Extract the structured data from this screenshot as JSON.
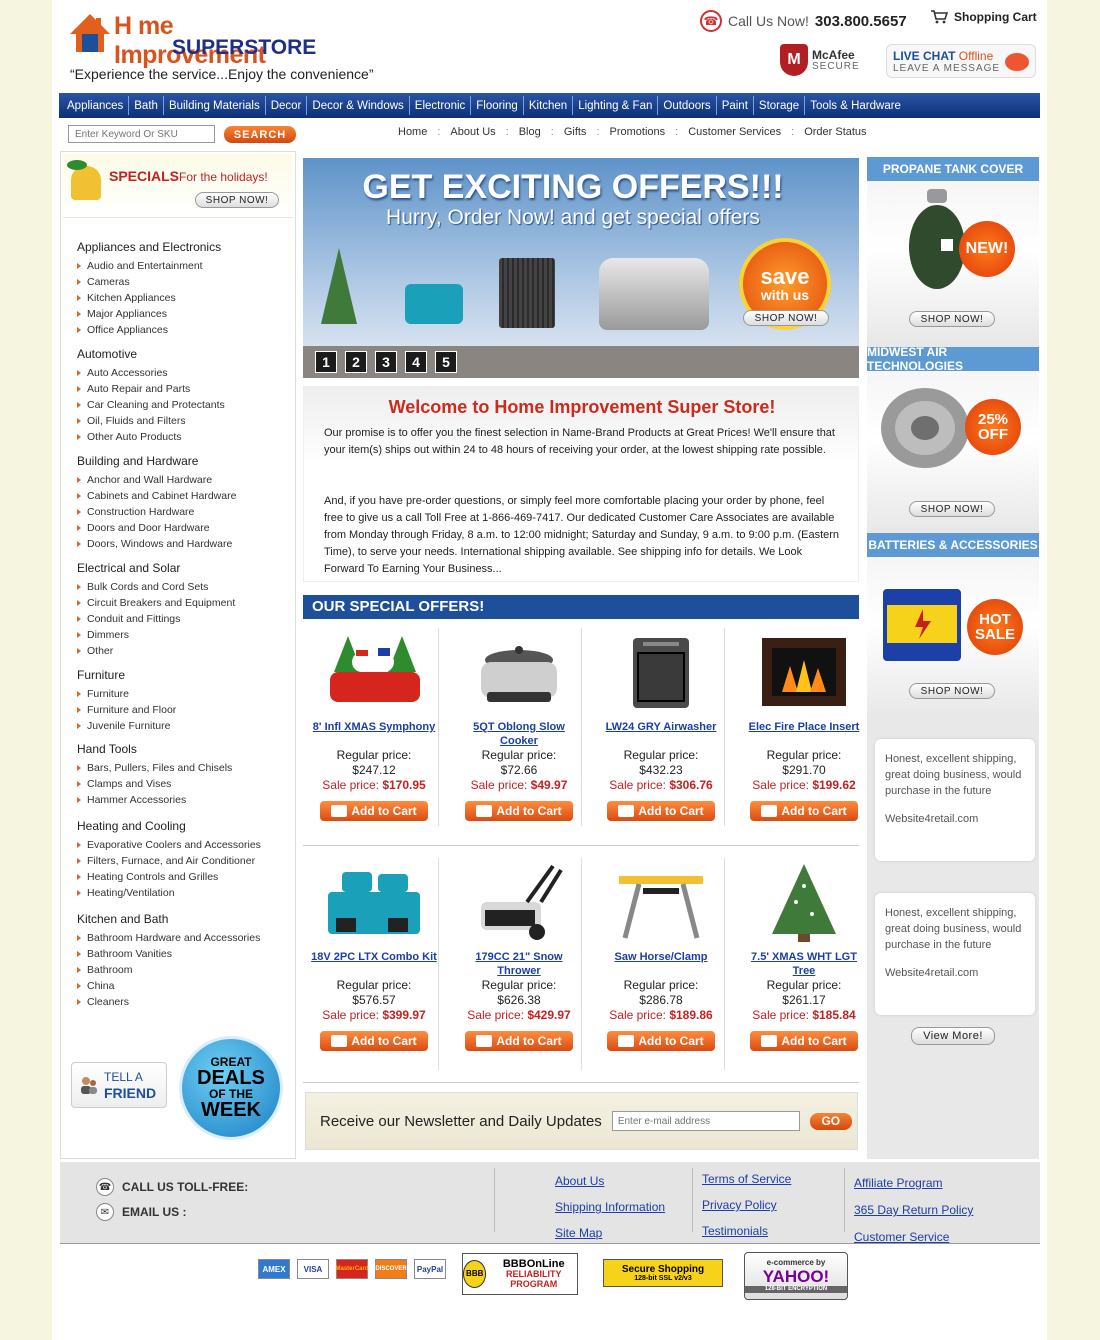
{
  "header": {
    "logo_line1": "H me Improvement",
    "logo_line2": "SUPERSTORE",
    "tagline": "“Experience the service...Enjoy the convenience”",
    "call_label": "Call Us Now!",
    "phone": "303.800.5657",
    "cart_label": "Shopping Cart",
    "mcafee_title": "McAfee",
    "mcafee_sub": "SECURE",
    "chat_live": "LIVE CHAT",
    "chat_status": "Offline",
    "chat_sub": "LEAVE A MESSAGE"
  },
  "nav": [
    "Appliances",
    "Bath",
    "Building Materials",
    "Decor",
    "Decor & Windows",
    "Electronic",
    "Flooring",
    "Kitchen",
    "Lighting & Fan",
    "Outdoors",
    "Paint",
    "Storage",
    "Tools & Hardware"
  ],
  "search": {
    "placeholder": "Enter Keyword Or SKU",
    "button": "SEARCH"
  },
  "toplinks": [
    "Home",
    "About Us",
    "Blog",
    "Gifts",
    "Promotions",
    "Customer Services",
    "Order Status"
  ],
  "specials": {
    "title": "SPECIALS",
    "sub": "For the holidays!",
    "button": "SHOP NOW!"
  },
  "categories": [
    {
      "heading": "Appliances and Electronics",
      "items": [
        "Audio and Entertainment",
        "Cameras",
        "Kitchen Appliances",
        "Major Appliances",
        "Office Appliances"
      ]
    },
    {
      "heading": "Automotive",
      "items": [
        "Auto Accessories",
        "Auto Repair and Parts",
        "Car Cleaning and Protectants",
        "Oil, Fluids and Filters",
        "Other Auto Products"
      ]
    },
    {
      "heading": "Building and Hardware",
      "items": [
        "Anchor and Wall Hardware",
        "Cabinets and Cabinet Hardware",
        "Construction Hardware",
        "Doors and Door Hardware",
        "Doors, Windows and Hardware"
      ]
    },
    {
      "heading": "Electrical and Solar",
      "items": [
        "Bulk Cords and Cord Sets",
        "Circuit Breakers and Equipment",
        "Conduit and Fittings",
        "Dimmers",
        "Other"
      ]
    },
    {
      "heading": "Furniture",
      "items": [
        "Furniture",
        "Furniture and Floor",
        "Juvenile Furniture"
      ]
    },
    {
      "heading": "Hand Tools",
      "items": [
        "Bars, Pullers, Files and Chisels",
        "Clamps and Vises",
        "Hammer Accessories"
      ]
    },
    {
      "heading": "Heating and Cooling",
      "items": [
        "Evaporative Coolers and Accessories",
        "Filters, Furnace, and Air Conditioner",
        "Heating Controls and Grilles",
        "Heating/Ventilation"
      ]
    },
    {
      "heading": "Kitchen and Bath",
      "items": [
        "Bathroom Hardware and Accessories",
        "Bathroom Vanities",
        "Bathroom",
        "China",
        "Cleaners"
      ]
    }
  ],
  "tellfriend": {
    "line1": "TELL A",
    "line2": "FRIEND"
  },
  "deals": {
    "l1": "GREAT",
    "l2": "DEALS",
    "l3": "OF THE",
    "l4": "WEEK"
  },
  "banner": {
    "headline": "GET EXCITING OFFERS!!!",
    "subline": "Hurry, Order Now! and get special offers",
    "save1": "save",
    "save2": "with us",
    "button": "SHOP NOW!",
    "slides": [
      "1",
      "2",
      "3",
      "4",
      "5"
    ]
  },
  "welcome": {
    "title": "Welcome to Home Improvement Super Store!",
    "p1": "Our promise is to offer you the finest selection in Name-Brand Products at Great Prices! We'll ensure that your item(s) ships out within 24 to 48 hours of receiving your order, at the lowest shipping rate possible.",
    "p2": "And, if you have pre-order questions, or simply feel more comfortable placing your order by phone, feel free to give us a call Toll Free at 1-866-469-7417. Our dedicated Customer Care Associates are available from Monday through Friday, 8 a.m. to 12:00 midnight; Saturday and Sunday, 9 a.m. to 9:00 p.m. (Eastern Time), to serve your needs. International shipping available. See shipping info for details. We Look Forward To Earning Your Business..."
  },
  "offers": {
    "heading": "OUR SPECIAL OFFERS!",
    "regular_label": "Regular price:",
    "sale_label": "Sale price:",
    "add_label": "Add to Cart",
    "products": [
      {
        "name": "8' Infl XMAS Symphony",
        "regular": "$247.12",
        "sale": "$170.95",
        "icon": "inflatable-santa"
      },
      {
        "name": "5QT Oblong Slow Cooker",
        "regular": "$72.66",
        "sale": "$49.97",
        "icon": "slow-cooker"
      },
      {
        "name": "LW24 GRY Airwasher",
        "regular": "$432.23",
        "sale": "$306.76",
        "icon": "airwasher"
      },
      {
        "name": "Elec Fire Place Insert",
        "regular": "$291.70",
        "sale": "$199.62",
        "icon": "fireplace"
      },
      {
        "name": "18V 2PC LTX Combo Kit",
        "regular": "$576.57",
        "sale": "$399.97",
        "icon": "drill-kit"
      },
      {
        "name": "179CC 21\" Snow Thrower",
        "regular": "$626.38",
        "sale": "$429.97",
        "icon": "snow-thrower"
      },
      {
        "name": "Saw Horse/Clamp",
        "regular": "$286.78",
        "sale": "$189.86",
        "icon": "saw-horse"
      },
      {
        "name": "7.5' XMAS WHT LGT Tree",
        "regular": "$261.17",
        "sale": "$185.84",
        "icon": "xmas-tree"
      }
    ]
  },
  "newsletter": {
    "label": "Receive our Newsletter and Daily Updates",
    "placeholder": "Enter e-mail address",
    "button": "GO"
  },
  "right": {
    "boxes": [
      {
        "title": "PROPANE TANK COVER",
        "badge": "NEW!",
        "button": "SHOP NOW!"
      },
      {
        "title": "MIDWEST AIR TECHNOLOGIES",
        "badge": "25% OFF",
        "button": "SHOP NOW!"
      },
      {
        "title": "BATTERIES & ACCESSORIES",
        "badge": "HOT SALE",
        "button": "SHOP NOW!"
      }
    ],
    "testimonials": [
      {
        "text": "Honest, excellent shipping, great doing business, would purchase in the future",
        "from": "Website4retail.com"
      },
      {
        "text": "Honest, excellent shipping, great doing business, would purchase in the future",
        "from": "Website4retail.com"
      }
    ],
    "view_more": "View More!"
  },
  "footer": {
    "toll_free": "CALL US TOLL-FREE:",
    "email": "EMAIL US :",
    "col1": [
      "About Us",
      "Shipping Information",
      "Site Map"
    ],
    "col2": [
      "Terms of Service",
      "Privacy Policy",
      "Testimonials"
    ],
    "col3": [
      "Affiliate Program",
      "365 Day Return Policy",
      "Customer Service"
    ]
  },
  "badges": {
    "cards": [
      "AMEX",
      "VISA",
      "MasterCard",
      "DISCOVER",
      "PayPal"
    ],
    "bbb1": "BBBOnLine",
    "bbb2": "RELIABILITY PROGRAM",
    "secure1": "Secure Shopping",
    "secure2": "128-bit SSL v2/v3",
    "yahoo1": "e-commerce by",
    "yahoo2": "YAHOO!",
    "yahoo3": "128-BIT ENCRYPTION"
  },
  "colors": {
    "nav": "#0d2f7a",
    "accent_orange": "#e0602b",
    "sale_red": "#c51f1f",
    "link_blue": "#1b3ea8",
    "right_header": "#5d9ad4"
  }
}
